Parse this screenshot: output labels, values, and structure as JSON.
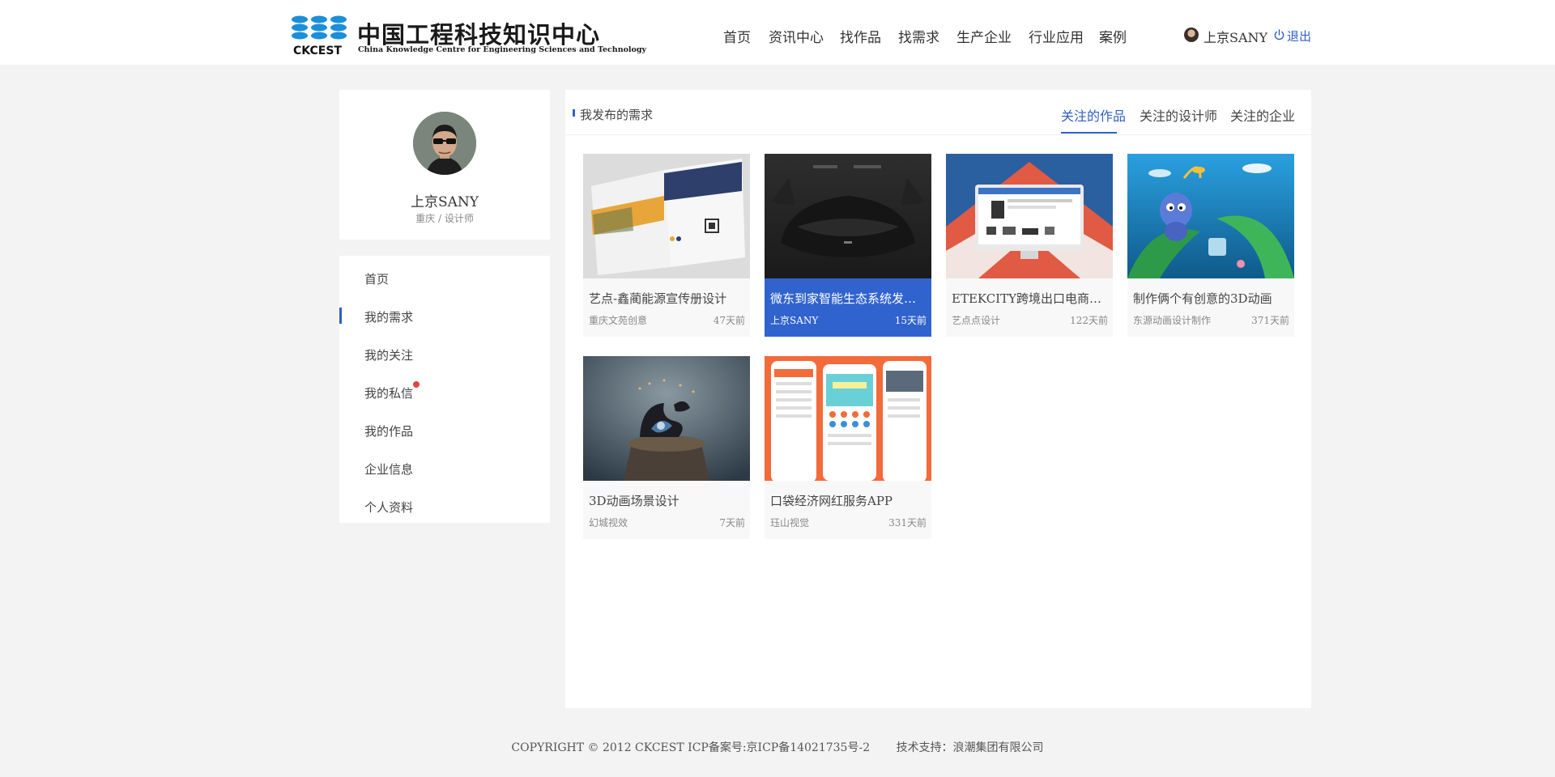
{
  "site": {
    "logo_title": "中国工程科技知识中心",
    "logo_subtitle": "China Knowledge Centre for Engineering Sciences and Technology",
    "logo_mark_text": "CKCEST"
  },
  "nav": [
    {
      "label": "首页"
    },
    {
      "label": "资讯中心"
    },
    {
      "label": "找作品"
    },
    {
      "label": "找需求"
    },
    {
      "label": "生产企业"
    },
    {
      "label": "行业应用"
    },
    {
      "label": "案例"
    }
  ],
  "user": {
    "name": "上京SANY",
    "location_role": "重庆 / 设计师",
    "logout_label": "退出"
  },
  "side_menu": [
    {
      "label": "首页",
      "active": false
    },
    {
      "label": "我的需求",
      "active": true
    },
    {
      "label": "我的关注",
      "active": false
    },
    {
      "label": "我的私信",
      "active": false,
      "unread": true
    },
    {
      "label": "我的作品",
      "active": false
    },
    {
      "label": "企业信息",
      "active": false
    },
    {
      "label": "个人资料",
      "active": false
    }
  ],
  "main": {
    "section_title": "我发布的需求",
    "tabs": [
      {
        "label": "关注的作品",
        "active": true
      },
      {
        "label": "关注的设计师",
        "active": false
      },
      {
        "label": "关注的企业",
        "active": false
      }
    ]
  },
  "works": [
    {
      "title": "艺点-鑫蔺能源宣传册设计",
      "author": "重庆文苑创意",
      "time": "47天前",
      "selected": false,
      "thumb": "brochure"
    },
    {
      "title": "微东到家智能生态系统发布会主视觉设计",
      "author": "上京SANY",
      "time": "15天前",
      "selected": true,
      "thumb": "car"
    },
    {
      "title": "ETEKCITY跨境出口电商平台",
      "author": "艺点点设计",
      "time": "122天前",
      "selected": false,
      "thumb": "monitor"
    },
    {
      "title": "制作俩个有创意的3D动画",
      "author": "东源动画设计制作",
      "time": "371天前",
      "selected": false,
      "thumb": "bug"
    },
    {
      "title": "3D动画场景设计",
      "author": "幻城视效",
      "time": "7天前",
      "selected": false,
      "thumb": "sculpture"
    },
    {
      "title": "口袋经济网红服务APP",
      "author": "珏山视觉",
      "time": "331天前",
      "selected": false,
      "thumb": "phones"
    }
  ],
  "footer": {
    "copyright": "COPYRIGHT © 2012 CKCEST ICP备案号:京ICP备14021735号-2",
    "support": "技术支持：浪潮集团有限公司"
  },
  "colors": {
    "accent": "#2f5fc8",
    "selected_card": "#3063cd",
    "page_bg": "#f3f3f3",
    "badge": "#e8433a"
  }
}
